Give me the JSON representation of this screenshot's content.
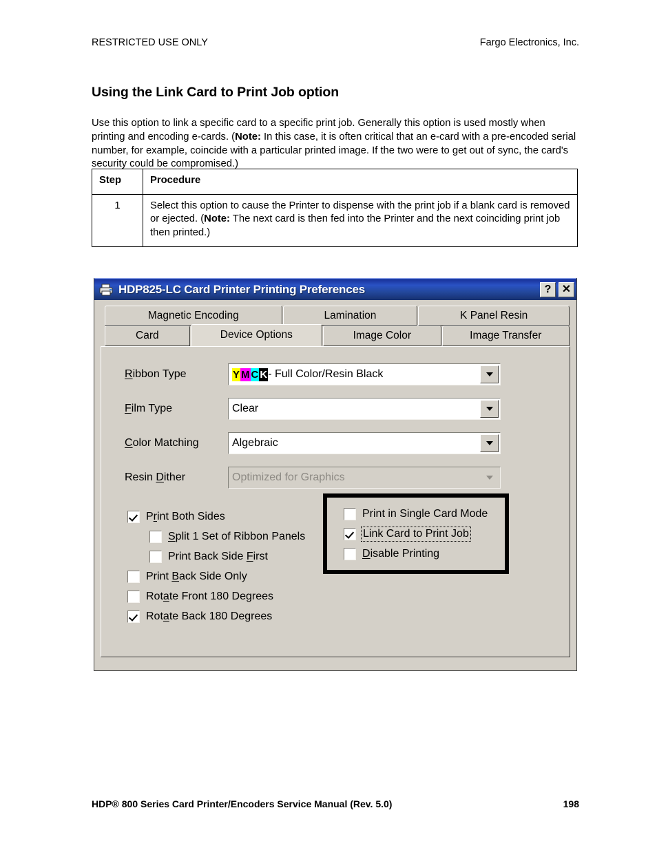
{
  "page": {
    "header_left": "RESTRICTED USE ONLY",
    "header_right": "Fargo Electronics, Inc.",
    "title": "Using the Link Card to Print Job option",
    "footer_left": "HDP® 800 Series Card Printer/Encoders Service Manual (Rev. 5.0)",
    "footer_page": "198",
    "intro": {
      "part1": "Use this option to link a specific card to a specific print job. Generally this option is used mostly when printing and encoding e-cards. (",
      "note_label": "Note:",
      "part2": " In this case, it is often critical that an e-card with a pre-encoded serial number, for example, coincide with a particular printed image. If the two were to get out of sync, the card's security could be compromised.)"
    }
  },
  "table": {
    "headers": [
      "Step",
      "Procedure"
    ],
    "rows": [
      {
        "step": "1",
        "text_part1": "Select this option to cause the Printer to dispense with the print job if a blank card is removed or ejected. (",
        "note_label": "Note:",
        "text_part2": " The next card is then fed into the Printer and the next coinciding print job then printed.)"
      }
    ]
  },
  "dialog": {
    "title": "HDP825-LC Card Printer Printing Preferences",
    "help_button": "?",
    "close_button": "✕",
    "tabs_row1": [
      {
        "label": "Magnetic Encoding",
        "selected": false
      },
      {
        "label": "Lamination",
        "selected": false
      },
      {
        "label": "K Panel Resin",
        "selected": false
      }
    ],
    "tabs_row2": [
      {
        "label": "Card",
        "selected": false
      },
      {
        "label": "Device Options",
        "selected": true
      },
      {
        "label": "Image Color",
        "selected": false
      },
      {
        "label": "Image Transfer",
        "selected": false
      }
    ],
    "fields": [
      {
        "label_accel": "R",
        "label_rest": "ibbon Type",
        "value_prefix": "YMCK",
        "value": " - Full Color/Resin Black",
        "disabled": false
      },
      {
        "label_accel": "F",
        "label_rest": "ilm Type",
        "value": "Clear",
        "disabled": false
      },
      {
        "label_accel": "C",
        "label_rest": "olor Matching",
        "value": "Algebraic",
        "disabled": false
      },
      {
        "label_prefix": "Resin ",
        "label_accel": "D",
        "label_rest": "ither",
        "value": "Optimized for Graphics",
        "disabled": true
      }
    ],
    "left_checkboxes": [
      {
        "pre": "P",
        "accel": "r",
        "post": "int Both Sides",
        "checked": true,
        "indent": false
      },
      {
        "pre": "",
        "accel": "S",
        "post": "plit 1 Set of Ribbon Panels",
        "checked": false,
        "indent": true
      },
      {
        "pre": "Print Back Side ",
        "accel": "F",
        "post": "irst",
        "checked": false,
        "indent": true
      },
      {
        "pre": "Print ",
        "accel": "B",
        "post": "ack Side Only",
        "checked": false,
        "indent": false
      },
      {
        "pre": "Rot",
        "accel": "a",
        "post": "te Front 180 Degrees",
        "checked": false,
        "indent": false
      },
      {
        "pre": "Rot",
        "accel": "a",
        "post": "te Back 180 Degrees",
        "checked": true,
        "indent": false
      }
    ],
    "right_checkboxes": [
      {
        "pre": "Print in Single Card Mode",
        "accel": "",
        "post": "",
        "checked": false,
        "focused": false
      },
      {
        "pre": "Link Card to Print Job",
        "accel": "",
        "post": "",
        "checked": true,
        "focused": true
      },
      {
        "pre": "",
        "accel": "D",
        "post": "isable Printing",
        "checked": false,
        "focused": false
      }
    ]
  },
  "colors": {
    "titlebar_blue": "#1c37a0",
    "dialog_face": "#d4d0c8",
    "yellow": "#ffff00",
    "magenta": "#ff00ff",
    "cyan": "#00ffff",
    "black": "#000000"
  }
}
